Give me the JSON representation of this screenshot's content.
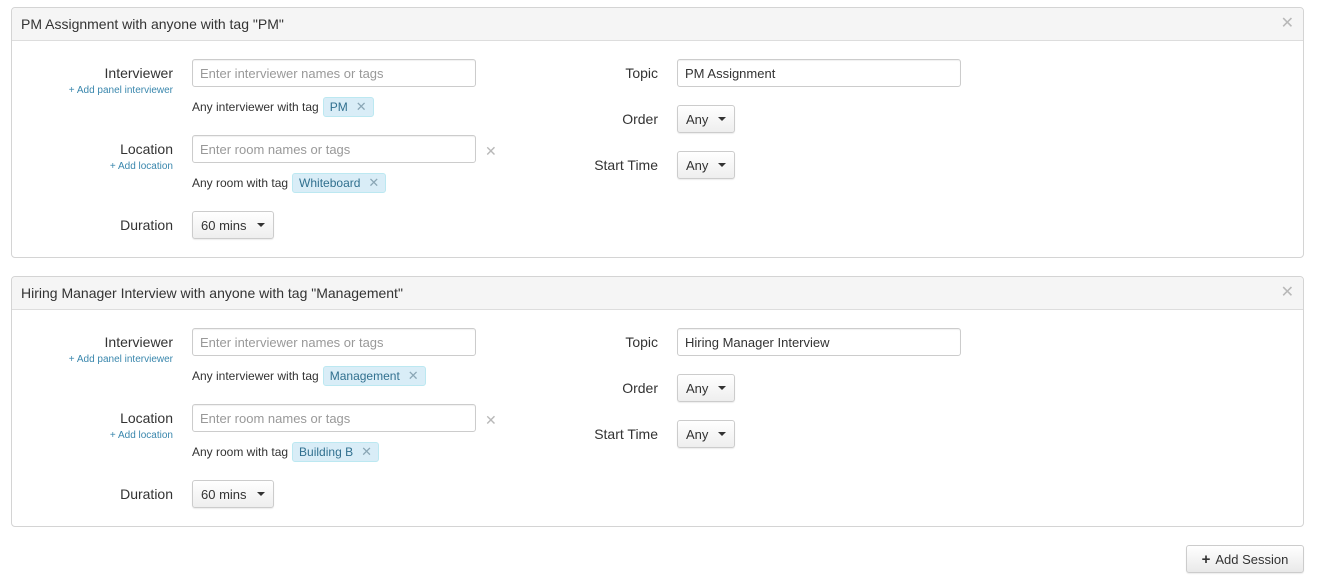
{
  "sessions": [
    {
      "title": "PM Assignment with anyone with tag \"PM\"",
      "close_icon": "✕",
      "interviewer_label": "Interviewer",
      "add_panel_link": "+ Add panel interviewer",
      "interviewer_placeholder": "Enter interviewer names or tags",
      "interviewer_tag_prefix": "Any interviewer with tag",
      "interviewer_tag": "PM",
      "location_label": "Location",
      "add_location_link": "+ Add location",
      "location_placeholder": "Enter room names or tags",
      "location_tag_prefix": "Any room with tag",
      "location_tag": "Whiteboard",
      "duration_label": "Duration",
      "duration_value": "60 mins",
      "topic_label": "Topic",
      "topic_value": "PM Assignment",
      "order_label": "Order",
      "order_value": "Any",
      "start_time_label": "Start Time",
      "start_time_value": "Any"
    },
    {
      "title": "Hiring Manager Interview with anyone with tag \"Management\"",
      "close_icon": "✕",
      "interviewer_label": "Interviewer",
      "add_panel_link": "+ Add panel interviewer",
      "interviewer_placeholder": "Enter interviewer names or tags",
      "interviewer_tag_prefix": "Any interviewer with tag",
      "interviewer_tag": "Management",
      "location_label": "Location",
      "add_location_link": "+ Add location",
      "location_placeholder": "Enter room names or tags",
      "location_tag_prefix": "Any room with tag",
      "location_tag": "Building B",
      "duration_label": "Duration",
      "duration_value": "60 mins",
      "topic_label": "Topic",
      "topic_value": "Hiring Manager Interview",
      "order_label": "Order",
      "order_value": "Any",
      "start_time_label": "Start Time",
      "start_time_value": "Any"
    }
  ],
  "tag_remove_icon": "✕",
  "row_remove_icon": "✕",
  "add_session": {
    "icon": "+",
    "label": "Add Session"
  },
  "icons": {
    "close": "close-icon",
    "tag_remove": "remove-tag-icon",
    "plus": "plus-icon",
    "caret": "caret-down-icon"
  },
  "colors": {
    "link": "#3a87ad",
    "tag_bg": "#d9edf7",
    "tag_text": "#31708f",
    "header_bg": "#f5f5f5"
  }
}
